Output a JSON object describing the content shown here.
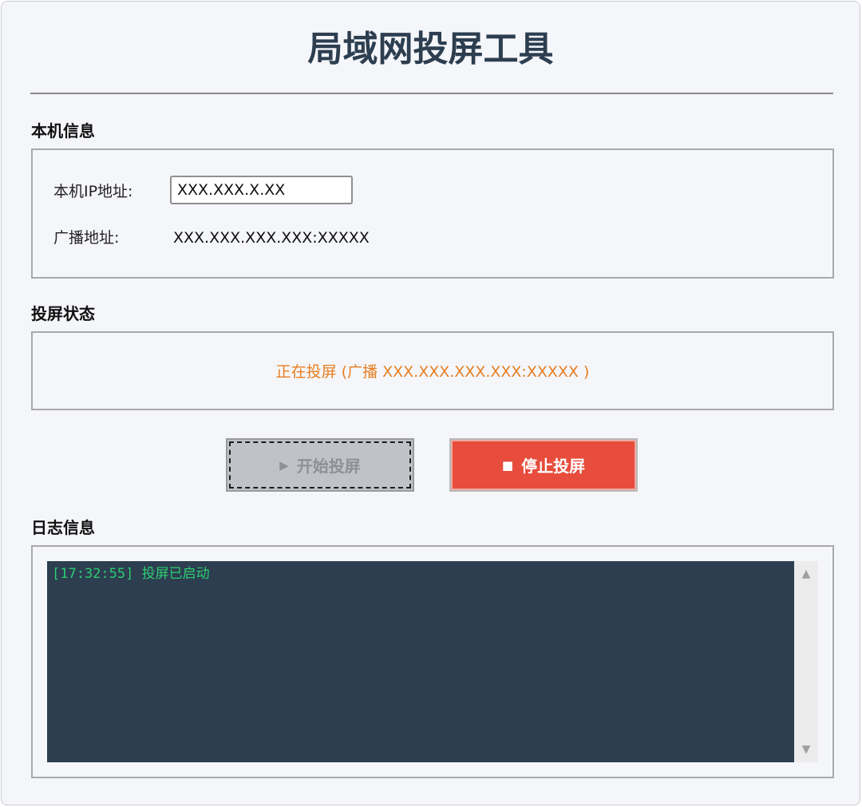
{
  "app": {
    "title": "局域网投屏工具"
  },
  "local_info": {
    "section_label": "本机信息",
    "ip_label": "本机IP地址:",
    "ip_value": "XXX.XXX.X.XX",
    "broadcast_label": "广播地址:",
    "broadcast_value": "XXX.XXX.XXX.XXX:XXXXX"
  },
  "status": {
    "section_label": "投屏状态",
    "text": "正在投屏 (广播 XXX.XXX.XXX.XXX:XXXXX )",
    "color": "#e67e22"
  },
  "controls": {
    "start_glyph": "▶",
    "start_label": "开始投屏",
    "start_state": "disabled",
    "stop_glyph": "■",
    "stop_label": "停止投屏",
    "stop_color": "#e74c3c"
  },
  "log": {
    "section_label": "日志信息",
    "entries": [
      "[17:32:55] 投屏已启动"
    ],
    "text_color": "#2ecc71",
    "background": "#2c3e50"
  },
  "icons": {
    "scroll_up": "scroll-up-arrow-icon",
    "scroll_down": "scroll-down-arrow-icon"
  }
}
